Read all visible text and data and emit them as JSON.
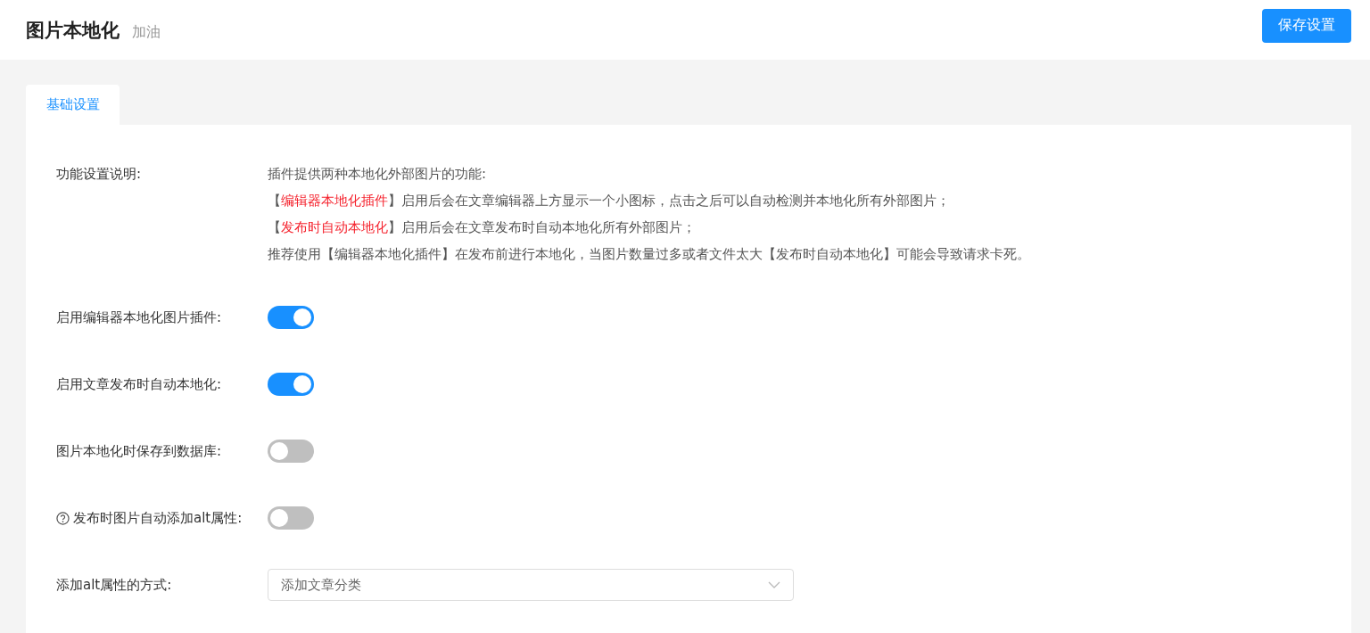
{
  "header": {
    "title": "图片本地化",
    "subtitle": "加油",
    "save_button": "保存设置"
  },
  "tabs": [
    {
      "label": "基础设置",
      "selected": true
    }
  ],
  "description": {
    "label": "功能设置说明:",
    "lines": [
      [
        {
          "text": "插件提供两种本地化外部图片的功能:",
          "highlight": false
        }
      ],
      [
        {
          "text": "【",
          "highlight": false
        },
        {
          "text": "编辑器本地化插件",
          "highlight": true
        },
        {
          "text": "】启用后会在文章编辑器上方显示一个小图标，点击之后可以自动检测并本地化所有外部图片；",
          "highlight": false
        }
      ],
      [
        {
          "text": "【",
          "highlight": false
        },
        {
          "text": "发布时自动本地化",
          "highlight": true
        },
        {
          "text": "】启用后会在文章发布时自动本地化所有外部图片；",
          "highlight": false
        }
      ],
      [
        {
          "text": "推荐使用【编辑器本地化插件】在发布前进行本地化，当图片数量过多或者文件太大【发布时自动本地化】可能会导致请求卡死。",
          "highlight": false
        }
      ]
    ]
  },
  "settings": [
    {
      "kind": "toggle",
      "label": "启用编辑器本地化图片插件:",
      "help": false,
      "on": true
    },
    {
      "kind": "toggle",
      "label": "启用文章发布时自动本地化:",
      "help": false,
      "on": true
    },
    {
      "kind": "toggle",
      "label": "图片本地化时保存到数据库:",
      "help": false,
      "on": false
    },
    {
      "kind": "toggle",
      "label": "发布时图片自动添加alt属性:",
      "help": true,
      "on": false
    },
    {
      "kind": "select",
      "label": "添加alt属性的方式:",
      "help": false,
      "value": "添加文章分类"
    }
  ]
}
